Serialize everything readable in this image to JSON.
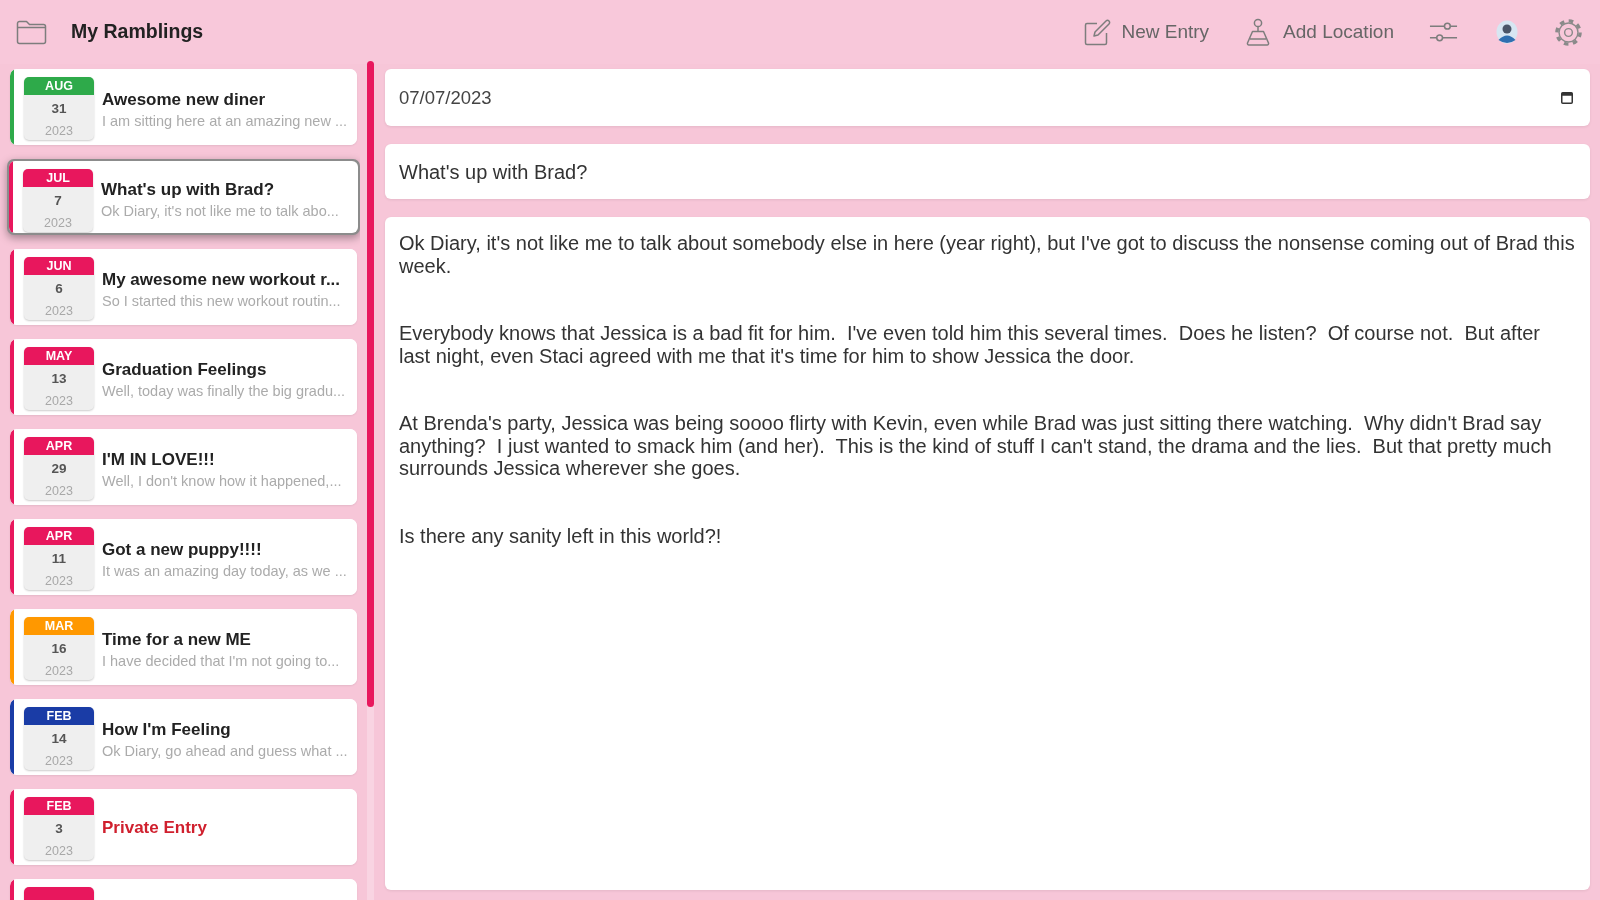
{
  "app": {
    "title": "My Ramblings"
  },
  "toolbar": {
    "new_entry": {
      "label": "New Entry"
    },
    "add_location": {
      "label": "Add Location"
    }
  },
  "entries": [
    {
      "kind": "entry",
      "month": "AUG",
      "day": "31",
      "year": "2023",
      "title": "Awesome new diner",
      "preview": "I am sitting here at an amazing new ...",
      "color": "#2eaa4a",
      "selected": false
    },
    {
      "kind": "entry",
      "month": "JUL",
      "day": "7",
      "year": "2023",
      "title": "What's up with Brad?",
      "preview": "Ok Diary, it's not like me to talk abo...",
      "color": "#e8175d",
      "selected": true
    },
    {
      "kind": "entry",
      "month": "JUN",
      "day": "6",
      "year": "2023",
      "title": "My awesome new workout r...",
      "preview": "So I started this new workout routin...",
      "color": "#e8175d",
      "selected": false
    },
    {
      "kind": "entry",
      "month": "MAY",
      "day": "13",
      "year": "2023",
      "title": "Graduation Feelings",
      "preview": "Well, today was finally the big gradu...",
      "color": "#e8175d",
      "selected": false
    },
    {
      "kind": "entry",
      "month": "APR",
      "day": "29",
      "year": "2023",
      "title": "I'M IN LOVE!!!",
      "preview": "Well, I don't know how it happened,...",
      "color": "#e8175d",
      "selected": false
    },
    {
      "kind": "entry",
      "month": "APR",
      "day": "11",
      "year": "2023",
      "title": "Got a new puppy!!!!",
      "preview": "It was an amazing day today, as we ...",
      "color": "#e8175d",
      "selected": false
    },
    {
      "kind": "entry",
      "month": "MAR",
      "day": "16",
      "year": "2023",
      "title": "Time for a new ME",
      "preview": "I have decided that I'm not going to...",
      "color": "#ff9800",
      "selected": false
    },
    {
      "kind": "entry",
      "month": "FEB",
      "day": "14",
      "year": "2023",
      "title": "How I'm Feeling",
      "preview": "Ok Diary, go ahead and guess what ...",
      "color": "#1a3ca6",
      "selected": false
    },
    {
      "kind": "private",
      "month": "FEB",
      "day": "3",
      "year": "2023",
      "title": "Private Entry",
      "color": "#e8175d",
      "selected": false
    },
    {
      "kind": "partial",
      "color": "#e8175d",
      "selected": false
    }
  ],
  "editor": {
    "date": "07/07/2023",
    "title": "What's up with Brad?",
    "body": "Ok Diary, it's not like me to talk about somebody else in here (year right), but I've got to discuss the nonsense coming out of Brad this week.\n\n\nEverybody knows that Jessica is a bad fit for him.  I've even told him this several times.  Does he listen?  Of course not.  But after last night, even Staci agreed with me that it's time for him to show Jessica the door.\n\n\nAt Brenda's party, Jessica was being soooo flirty with Kevin, even while Brad was just sitting there watching.  Why didn't Brad say anything?  I just wanted to smack him (and her).  This is the kind of stuff I can't stand, the drama and the lies.  But that pretty much surrounds Jessica wherever she goes.\n\n\nIs there any sanity left in this world?!"
  }
}
